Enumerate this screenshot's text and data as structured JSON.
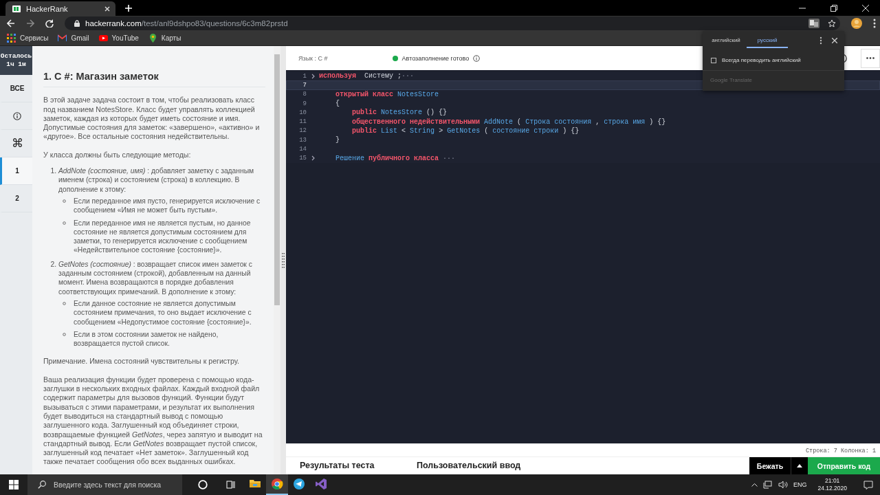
{
  "browser": {
    "tab": {
      "title": "HackerRank"
    },
    "url": {
      "host": "hackerrank.com",
      "path": "/test/anl9dshpo83/questions/6c3m82prstd"
    },
    "bookmarks": [
      {
        "kind": "apps",
        "label": "Сервисы"
      },
      {
        "kind": "gmail",
        "label": "Gmail"
      },
      {
        "kind": "youtube",
        "label": "YouTube"
      },
      {
        "kind": "maps",
        "label": "Карты"
      }
    ]
  },
  "translate_popup": {
    "tabs": [
      {
        "label": "английский",
        "selected": false
      },
      {
        "label": "русский",
        "selected": true
      }
    ],
    "option": {
      "label": "Всегда переводить английский",
      "checked": false
    },
    "footer": "Google Translate"
  },
  "sidebar": {
    "timer": {
      "label": "Осталось",
      "value": "1ч 1м"
    },
    "items": [
      {
        "kind": "text",
        "label": "ВСЕ",
        "selected": false
      },
      {
        "kind": "info",
        "selected": false
      },
      {
        "kind": "text",
        "label": "⌘",
        "selected": false
      },
      {
        "kind": "question",
        "label": "1",
        "selected": true
      },
      {
        "kind": "question",
        "label": "2",
        "selected": false
      }
    ]
  },
  "problem": {
    "title": "1. C #: Магазин заметок",
    "blocks": [
      {
        "kind": "paragraph",
        "text": "В этой задаче задача состоит в том, чтобы реализовать класс под названием NotesStore. Класс будет управлять коллекцией заметок, каждая из которых будет иметь состояние и имя. Допустимые состояния для заметок: «завершено», «активно» и «другое». Все остальные состояния недействительны."
      },
      {
        "kind": "paragraph",
        "text": "У класса должны быть следующие методы:"
      },
      {
        "kind": "list",
        "items": [
          {
            "number": "1.",
            "text": "*AddNote (состояние, имя)* : добавляет заметку с заданным именем (строка) и состоянием (строка) в коллекцию. В дополнение к этому:",
            "bullets": [
              "Если переданное имя пусто, генерируется исключение с сообщением «Имя не может быть пустым».",
              "Если переданное имя не является пустым, но данное состояние не является допустимым состоянием для заметки, то генерируется исключение с сообщением «Недействительное состояние {состояние}»."
            ]
          },
          {
            "number": "2.",
            "text": "*GetNotes (состояние)* : возвращает список имен заметок с заданным состоянием (строкой), добавленным на данный момент. Имена возвращаются в порядке добавления соответствующих примечаний. В дополнение к этому:",
            "bullets": [
              "Если данное состояние не является допустимым состоянием примечания, то оно выдает исключение с сообщением «Недопустимое состояние {состояние}».",
              "Если в этом состоянии заметок не найдено, возвращается пустой список."
            ]
          }
        ]
      },
      {
        "kind": "paragraph",
        "text": "Примечание. Имена состояний чувствительны к регистру."
      },
      {
        "kind": "paragraph",
        "text": "Ваша реализация функции будет проверена с помощью кода-заглушки в нескольких входных файлах. Каждый входной файл содержит параметры для вызовов функций. Функции будут вызываться с этими параметрами, и результат их выполнения будет выводиться на стандартный вывод с помощью заглушенного кода. Заглушенный код объединяет строки, возвращаемые функцией *GetNotes*, через запятую и выводит на стандартный вывод. Если *GetNotes* возвращает пустой список, заглушенный код печатает «Нет заметок». Заглушенный код также печатает сообщения обо всех выданных ошибках."
      }
    ]
  },
  "editor": {
    "language": "Язык : C #",
    "autocomplete": "Автозаполнение готово",
    "lines": [
      {
        "number": "1",
        "folded": true,
        "current": false,
        "tokens": [
          {
            "kind": "keyword",
            "text": "используя"
          },
          {
            "kind": "plain",
            "text": " Систему ;"
          },
          {
            "kind": "ellipsis",
            "text": "···"
          }
        ]
      },
      {
        "number": "7",
        "folded": false,
        "current": true
      },
      {
        "number": "8",
        "folded": false,
        "current": false,
        "tokens": [
          {
            "kind": "keyword",
            "text": "    открытый класс"
          },
          {
            "kind": "type",
            "text": "NotesStore"
          }
        ]
      },
      {
        "number": "9",
        "folded": false,
        "current": false,
        "tokens": [
          {
            "kind": "plain",
            "text": "    {"
          }
        ]
      },
      {
        "number": "10",
        "folded": false,
        "current": false,
        "tokens": [
          {
            "kind": "keyword",
            "text": "        public"
          },
          {
            "kind": "type",
            "text": "NotesStore"
          },
          {
            "kind": "plain",
            "text": "() {}"
          }
        ]
      },
      {
        "number": "11",
        "folded": false,
        "current": false,
        "tokens": [
          {
            "kind": "keyword",
            "text": "        общественного недействительными"
          },
          {
            "kind": "type",
            "text": "AddNote"
          },
          {
            "kind": "plain",
            "text": "("
          },
          {
            "kind": "type",
            "text": "Строка состояния"
          },
          {
            "kind": "plain",
            "text": ","
          },
          {
            "kind": "type",
            "text": "строка имя"
          },
          {
            "kind": "plain",
            "text": ") {}"
          }
        ]
      },
      {
        "number": "12",
        "folded": false,
        "current": false,
        "tokens": [
          {
            "kind": "keyword",
            "text": "        public"
          },
          {
            "kind": "type",
            "text": "List"
          },
          {
            "kind": "plain",
            "text": "<"
          },
          {
            "kind": "type",
            "text": "String"
          },
          {
            "kind": "plain",
            "text": ">"
          },
          {
            "kind": "type",
            "text": "GetNotes"
          },
          {
            "kind": "plain",
            "text": "("
          },
          {
            "kind": "type",
            "text": "состояние строки"
          },
          {
            "kind": "plain",
            "text": ") {}"
          }
        ]
      },
      {
        "number": "13",
        "folded": false,
        "current": false,
        "tokens": [
          {
            "kind": "plain",
            "text": "    }"
          }
        ]
      },
      {
        "number": "14",
        "folded": false,
        "current": false
      },
      {
        "number": "15",
        "folded": true,
        "current": false,
        "tokens": [
          {
            "kind": "type",
            "text": "    Решение"
          },
          {
            "kind": "keyword",
            "text": "публичного класса"
          },
          {
            "kind": "ellipsis",
            "text": " ···"
          }
        ]
      }
    ],
    "cursor": "Строка: 7 Колонка: 1"
  },
  "bottom_tabs": [
    {
      "label": "Результаты теста",
      "selected": false
    },
    {
      "label": "Пользовательский ввод",
      "selected": false
    }
  ],
  "buttons": {
    "run": "Бежать",
    "submit": "Отправить код"
  },
  "taskbar": {
    "search_placeholder": "Введите здесь текст для поиска",
    "apps": [
      {
        "kind": "explorer",
        "active": false
      },
      {
        "kind": "chrome",
        "active": true
      },
      {
        "kind": "telegram",
        "active": false
      },
      {
        "kind": "vs",
        "active": false
      }
    ],
    "language": "ENG",
    "time": "21:01",
    "date": "24.12.2020"
  }
}
